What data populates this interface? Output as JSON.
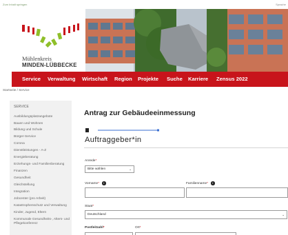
{
  "topbar": {
    "skip_label": "Zum Inhalt springen",
    "right_label": "Sprache"
  },
  "logo": {
    "line1": "Mühlenkreis",
    "line2": "MINDEN-LÜBBECKE",
    "colors": {
      "red": "#c8141b",
      "green": "#8fbf2a"
    }
  },
  "nav": {
    "items": [
      "Service",
      "Verwaltung",
      "Wirtschaft",
      "Region",
      "Projekte",
      "Suche",
      "Karriere",
      "Zensus 2022"
    ],
    "background": "#c8141b"
  },
  "breadcrumb": "Startseite / Service",
  "sidebar": {
    "title": "SERVICE",
    "items": [
      "Ausbildungsplatzangebote",
      "Bauen und Wohnen",
      "Bildung und Schule",
      "Bürger-Service",
      "Corona",
      "Dienstleistungen - A-Z",
      "Energieberatung",
      "Erziehungs- und Familienberatung",
      "Finanzen",
      "Gesundheit",
      "Gleichstellung",
      "Integration",
      "Jobcenter (pro Arbeit)",
      "Katastrophenschutz und Verwaltung",
      "Kinder, Jugend, Eltern",
      "Kommunale Gesundheits-, Alters- und Pflegekonferenz"
    ]
  },
  "form": {
    "title": "Antrag zur Gebäudeeinmessung",
    "section_title": "Auftraggeber*in",
    "anrede": {
      "label": "Anrede",
      "value": "Bitte wählen"
    },
    "vorname": {
      "label": "Vorname",
      "value": ""
    },
    "familienname": {
      "label": "Familienname",
      "value": ""
    },
    "staat": {
      "label": "Staat",
      "value": "Deutschland"
    },
    "postleitzahl": {
      "label": "Postleitzahl",
      "value": ""
    },
    "ort": {
      "label": "Ort",
      "value": ""
    },
    "required_mark": "*",
    "info_glyph": "i"
  }
}
